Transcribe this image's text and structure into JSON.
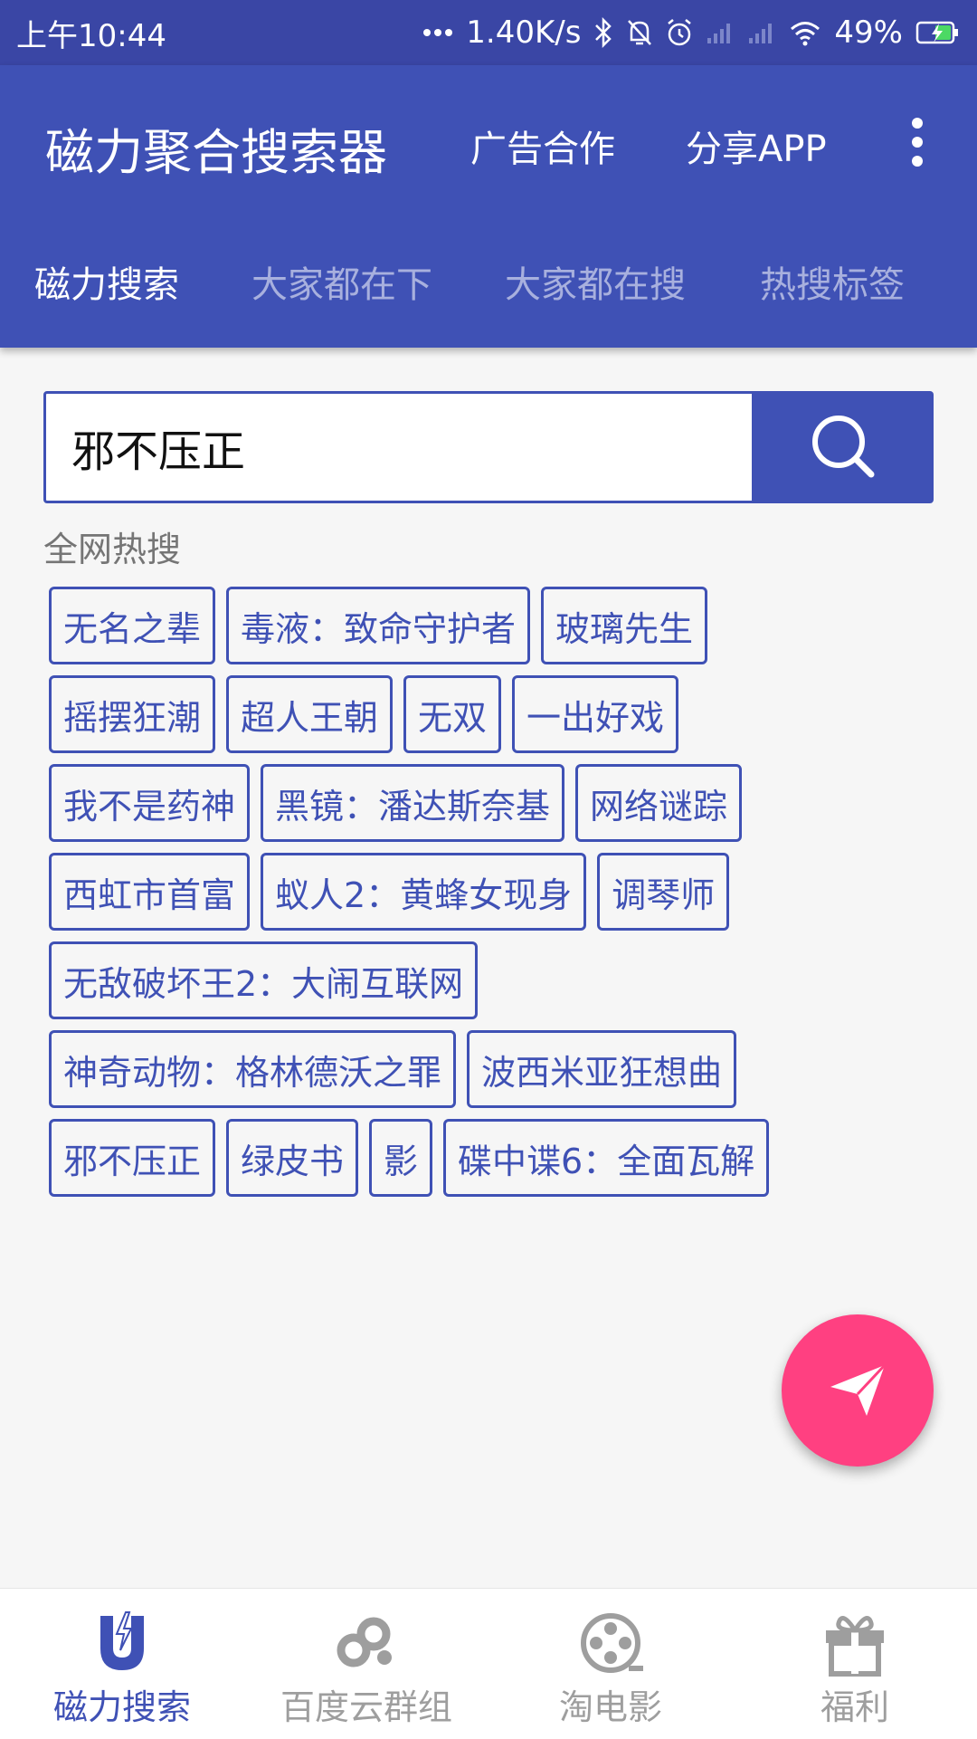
{
  "status_bar": {
    "time": "上午10:44",
    "network_speed": "1.40K/s",
    "battery": "49%"
  },
  "toolbar": {
    "title": "磁力聚合搜索器",
    "action_ad": "广告合作",
    "action_share": "分享APP"
  },
  "tabs": [
    {
      "label": "磁力搜索",
      "active": true
    },
    {
      "label": "大家都在下",
      "active": false
    },
    {
      "label": "大家都在搜",
      "active": false
    },
    {
      "label": "热搜标签",
      "active": false
    }
  ],
  "search": {
    "value": "邪不压正"
  },
  "hot_search": {
    "label": "全网热搜",
    "rows": [
      [
        "无名之辈",
        "毒液：致命守护者",
        "玻璃先生"
      ],
      [
        "摇摆狂潮",
        "超人王朝",
        "无双",
        "一出好戏"
      ],
      [
        "我不是药神",
        "黑镜：潘达斯奈基",
        "网络谜踪"
      ],
      [
        "西虹市首富",
        "蚁人2：黄蜂女现身",
        "调琴师"
      ],
      [
        "无敌破坏王2：大闹互联网"
      ],
      [
        "神奇动物：格林德沃之罪",
        "波西米亚狂想曲"
      ],
      [
        "邪不压正",
        "绿皮书",
        "影",
        "碟中谍6：全面瓦解"
      ]
    ]
  },
  "bottom_nav": [
    {
      "label": "磁力搜索",
      "icon": "magnet-icon",
      "active": true
    },
    {
      "label": "百度云群组",
      "icon": "cloud-group-icon",
      "active": false
    },
    {
      "label": "淘电影",
      "icon": "film-reel-icon",
      "active": false
    },
    {
      "label": "福利",
      "icon": "gift-icon",
      "active": false
    }
  ],
  "colors": {
    "primary": "#3f51b5",
    "status_bar": "#3a46a5",
    "accent": "#ff4081",
    "background": "#f6f6f6"
  }
}
